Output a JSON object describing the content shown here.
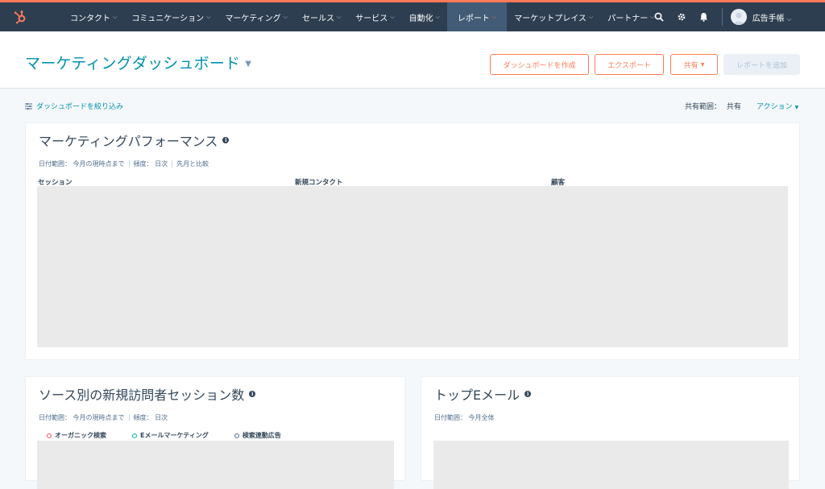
{
  "nav": {
    "logo_icon": "hubspot-sprocket-icon",
    "items": [
      {
        "label": "コンタクト"
      },
      {
        "label": "コミュニケーション"
      },
      {
        "label": "マーケティング"
      },
      {
        "label": "セールス"
      },
      {
        "label": "サービス"
      },
      {
        "label": "自動化"
      },
      {
        "label": "レポート",
        "active": true
      },
      {
        "label": "マーケットプレイス"
      },
      {
        "label": "パートナー"
      }
    ],
    "account_name": "広告手帳",
    "accent_color": "#ff7a59",
    "bg_color": "#2d3e50"
  },
  "header": {
    "title": "マーケティングダッシュボード",
    "buttons": {
      "create": "ダッシュボードを作成",
      "export": "エクスポート",
      "share": "共有",
      "add_report": "レポートを追加"
    }
  },
  "filterbar": {
    "filter_label": "ダッシュボードを絞り込み",
    "sharing_label": "共有範囲：",
    "sharing_value": "共有",
    "actions_label": "アクション"
  },
  "cards": {
    "performance": {
      "title": "マーケティングパフォーマンス",
      "date_range": "日付範囲： 今月の現時点まで",
      "frequency": "頻度： 日次",
      "compare": "先月と比較",
      "columns": [
        "セッション",
        "新規コンタクト",
        "顧客"
      ]
    },
    "sessions_by_source": {
      "title": "ソース別の新規訪問者セッション数",
      "date_range": "日付範囲： 今月の現時点まで",
      "frequency": "頻度： 日次",
      "legend": [
        {
          "label": "オーガニック検索",
          "color": "#f2545b"
        },
        {
          "label": "Eメールマーケティング",
          "color": "#00bda5"
        },
        {
          "label": "検索連動広告",
          "color": "#516f90"
        }
      ]
    },
    "top_emails": {
      "title": "トップEメール",
      "date_range": "日付範囲： 今月全体"
    }
  }
}
